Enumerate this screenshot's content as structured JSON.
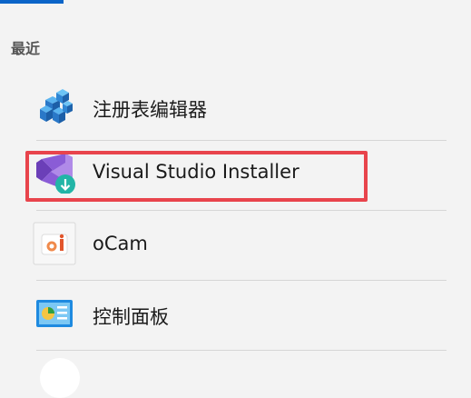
{
  "recent": {
    "heading": "最近",
    "items": [
      {
        "label": "注册表编辑器",
        "icon": "registry-editor-icon"
      },
      {
        "label": "Visual Studio Installer",
        "icon": "visual-studio-installer-icon"
      },
      {
        "label": "oCam",
        "icon": "ocam-icon"
      },
      {
        "label": "控制面板",
        "icon": "control-panel-icon"
      }
    ]
  },
  "colors": {
    "accent": "#0a64c8",
    "highlight": "#e8444c",
    "vs_purple": "#8a5cd6",
    "vs_badge": "#22b5a7"
  }
}
